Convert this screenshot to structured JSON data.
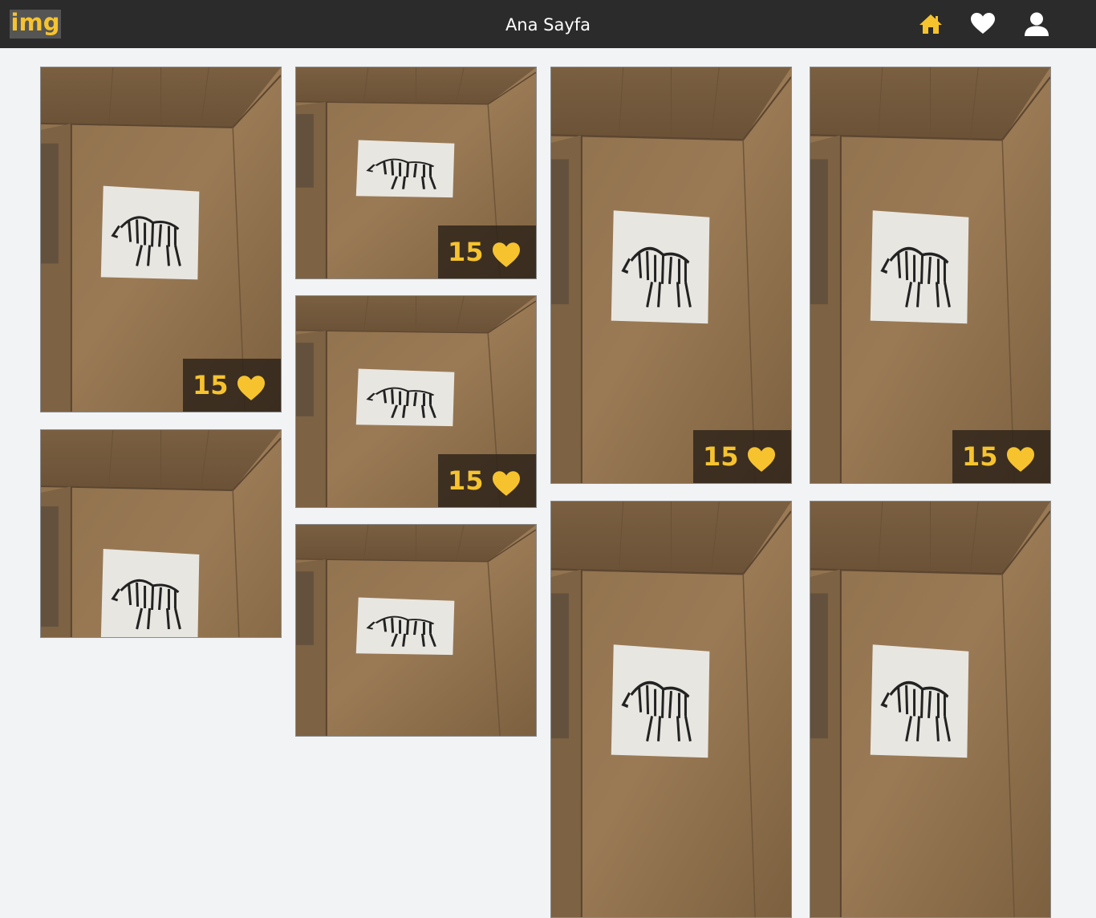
{
  "header": {
    "logo": "img",
    "title": "Ana Sayfa",
    "icons": [
      "home-icon",
      "heart-icon",
      "user-icon"
    ],
    "accent_color": "#f6c32f",
    "active_nav": "home"
  },
  "gallery": {
    "like_icon": "heart-icon",
    "items": [
      {
        "likes": "15"
      },
      {
        "likes": "15"
      },
      {
        "likes": "15"
      },
      {
        "likes": "15"
      },
      {
        "likes": "15"
      },
      {
        "likes": ""
      },
      {
        "likes": ""
      },
      {
        "likes": ""
      },
      {
        "likes": ""
      }
    ]
  }
}
